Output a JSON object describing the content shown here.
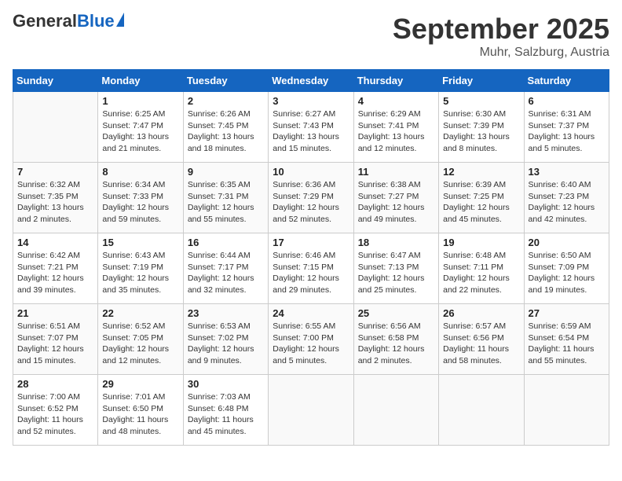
{
  "header": {
    "logo_general": "General",
    "logo_blue": "Blue",
    "month_title": "September 2025",
    "location": "Muhr, Salzburg, Austria"
  },
  "weekdays": [
    "Sunday",
    "Monday",
    "Tuesday",
    "Wednesday",
    "Thursday",
    "Friday",
    "Saturday"
  ],
  "weeks": [
    [
      {
        "day": "",
        "info": ""
      },
      {
        "day": "1",
        "info": "Sunrise: 6:25 AM\nSunset: 7:47 PM\nDaylight: 13 hours\nand 21 minutes."
      },
      {
        "day": "2",
        "info": "Sunrise: 6:26 AM\nSunset: 7:45 PM\nDaylight: 13 hours\nand 18 minutes."
      },
      {
        "day": "3",
        "info": "Sunrise: 6:27 AM\nSunset: 7:43 PM\nDaylight: 13 hours\nand 15 minutes."
      },
      {
        "day": "4",
        "info": "Sunrise: 6:29 AM\nSunset: 7:41 PM\nDaylight: 13 hours\nand 12 minutes."
      },
      {
        "day": "5",
        "info": "Sunrise: 6:30 AM\nSunset: 7:39 PM\nDaylight: 13 hours\nand 8 minutes."
      },
      {
        "day": "6",
        "info": "Sunrise: 6:31 AM\nSunset: 7:37 PM\nDaylight: 13 hours\nand 5 minutes."
      }
    ],
    [
      {
        "day": "7",
        "info": "Sunrise: 6:32 AM\nSunset: 7:35 PM\nDaylight: 13 hours\nand 2 minutes."
      },
      {
        "day": "8",
        "info": "Sunrise: 6:34 AM\nSunset: 7:33 PM\nDaylight: 12 hours\nand 59 minutes."
      },
      {
        "day": "9",
        "info": "Sunrise: 6:35 AM\nSunset: 7:31 PM\nDaylight: 12 hours\nand 55 minutes."
      },
      {
        "day": "10",
        "info": "Sunrise: 6:36 AM\nSunset: 7:29 PM\nDaylight: 12 hours\nand 52 minutes."
      },
      {
        "day": "11",
        "info": "Sunrise: 6:38 AM\nSunset: 7:27 PM\nDaylight: 12 hours\nand 49 minutes."
      },
      {
        "day": "12",
        "info": "Sunrise: 6:39 AM\nSunset: 7:25 PM\nDaylight: 12 hours\nand 45 minutes."
      },
      {
        "day": "13",
        "info": "Sunrise: 6:40 AM\nSunset: 7:23 PM\nDaylight: 12 hours\nand 42 minutes."
      }
    ],
    [
      {
        "day": "14",
        "info": "Sunrise: 6:42 AM\nSunset: 7:21 PM\nDaylight: 12 hours\nand 39 minutes."
      },
      {
        "day": "15",
        "info": "Sunrise: 6:43 AM\nSunset: 7:19 PM\nDaylight: 12 hours\nand 35 minutes."
      },
      {
        "day": "16",
        "info": "Sunrise: 6:44 AM\nSunset: 7:17 PM\nDaylight: 12 hours\nand 32 minutes."
      },
      {
        "day": "17",
        "info": "Sunrise: 6:46 AM\nSunset: 7:15 PM\nDaylight: 12 hours\nand 29 minutes."
      },
      {
        "day": "18",
        "info": "Sunrise: 6:47 AM\nSunset: 7:13 PM\nDaylight: 12 hours\nand 25 minutes."
      },
      {
        "day": "19",
        "info": "Sunrise: 6:48 AM\nSunset: 7:11 PM\nDaylight: 12 hours\nand 22 minutes."
      },
      {
        "day": "20",
        "info": "Sunrise: 6:50 AM\nSunset: 7:09 PM\nDaylight: 12 hours\nand 19 minutes."
      }
    ],
    [
      {
        "day": "21",
        "info": "Sunrise: 6:51 AM\nSunset: 7:07 PM\nDaylight: 12 hours\nand 15 minutes."
      },
      {
        "day": "22",
        "info": "Sunrise: 6:52 AM\nSunset: 7:05 PM\nDaylight: 12 hours\nand 12 minutes."
      },
      {
        "day": "23",
        "info": "Sunrise: 6:53 AM\nSunset: 7:02 PM\nDaylight: 12 hours\nand 9 minutes."
      },
      {
        "day": "24",
        "info": "Sunrise: 6:55 AM\nSunset: 7:00 PM\nDaylight: 12 hours\nand 5 minutes."
      },
      {
        "day": "25",
        "info": "Sunrise: 6:56 AM\nSunset: 6:58 PM\nDaylight: 12 hours\nand 2 minutes."
      },
      {
        "day": "26",
        "info": "Sunrise: 6:57 AM\nSunset: 6:56 PM\nDaylight: 11 hours\nand 58 minutes."
      },
      {
        "day": "27",
        "info": "Sunrise: 6:59 AM\nSunset: 6:54 PM\nDaylight: 11 hours\nand 55 minutes."
      }
    ],
    [
      {
        "day": "28",
        "info": "Sunrise: 7:00 AM\nSunset: 6:52 PM\nDaylight: 11 hours\nand 52 minutes."
      },
      {
        "day": "29",
        "info": "Sunrise: 7:01 AM\nSunset: 6:50 PM\nDaylight: 11 hours\nand 48 minutes."
      },
      {
        "day": "30",
        "info": "Sunrise: 7:03 AM\nSunset: 6:48 PM\nDaylight: 11 hours\nand 45 minutes."
      },
      {
        "day": "",
        "info": ""
      },
      {
        "day": "",
        "info": ""
      },
      {
        "day": "",
        "info": ""
      },
      {
        "day": "",
        "info": ""
      }
    ]
  ]
}
